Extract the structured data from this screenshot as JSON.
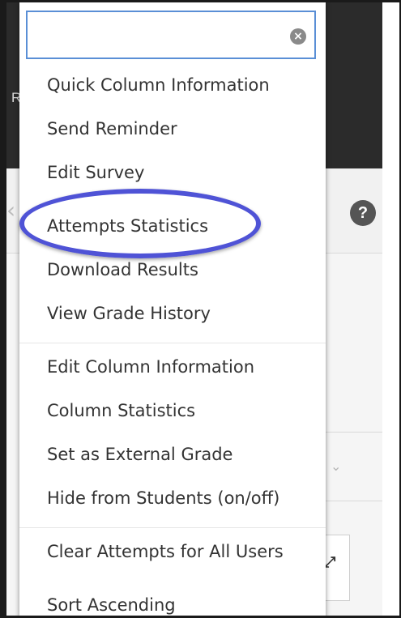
{
  "background": {
    "header_fragment": "Re",
    "help_glyph": "?",
    "expand_glyph": "⤢",
    "chevron_glyph": "⌄"
  },
  "search": {
    "value": "",
    "placeholder": "",
    "clear_icon": "×"
  },
  "menu": {
    "items": [
      {
        "label": "Quick Column Information"
      },
      {
        "label": "Send Reminder"
      },
      {
        "label": "Edit Survey"
      },
      {
        "label": "Attempts Statistics"
      },
      {
        "label": "Download Results"
      },
      {
        "label": "View Grade History"
      },
      {
        "label": "Edit Column Information"
      },
      {
        "label": "Column Statistics"
      },
      {
        "label": "Set as External Grade"
      },
      {
        "label": "Hide from Students (on/off)"
      },
      {
        "label": "Clear Attempts for All Users"
      },
      {
        "label": "Sort Ascending"
      }
    ],
    "highlighted_item": "Attempts Statistics",
    "highlight_color": "#4f53d6"
  },
  "colors": {
    "search_border": "#5a8fd6",
    "header_bg": "#2b2b2b",
    "menu_text": "#333333"
  }
}
